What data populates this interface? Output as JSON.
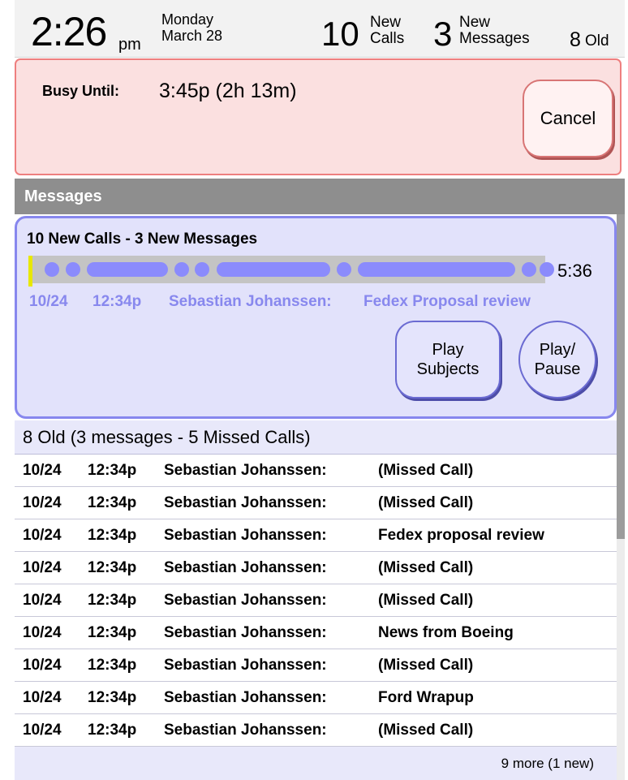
{
  "status_bar": {
    "time": "2:26",
    "ampm": "pm",
    "weekday": "Monday",
    "date": "March 28",
    "new_calls_count": "10",
    "new_calls_label_1": "New",
    "new_calls_label_2": "Calls",
    "new_messages_count": "3",
    "new_messages_label_1": "New",
    "new_messages_label_2": "Messages",
    "old_count": "8",
    "old_label": "Old"
  },
  "busy": {
    "label": "Busy Until:",
    "value": "3:45p (2h 13m)",
    "cancel_label": "Cancel"
  },
  "messages": {
    "header": "Messages",
    "new_summary": "10 New Calls - 3 New Messages",
    "total_duration": "5:36",
    "current": {
      "date": "10/24",
      "time": "12:34p",
      "name": "Sebastian Johanssen:",
      "subject": "Fedex Proposal review"
    },
    "play_subjects_line1": "Play",
    "play_subjects_line2": "Subjects",
    "play_pause_line1": "Play/",
    "play_pause_line2": "Pause",
    "colors": {
      "accent": "#8b8bfc",
      "playhead": "#e8e800",
      "card_bg": "#e2e2fb",
      "busy_bg": "#fbe0e0"
    }
  },
  "old_messages": {
    "header": "8 Old (3 messages - 5 Missed Calls)",
    "rows": [
      {
        "date": "10/24",
        "time": "12:34p",
        "name": "Sebastian Johanssen:",
        "subject": "(Missed Call)"
      },
      {
        "date": "10/24",
        "time": "12:34p",
        "name": "Sebastian Johanssen:",
        "subject": "(Missed Call)"
      },
      {
        "date": "10/24",
        "time": "12:34p",
        "name": "Sebastian Johanssen:",
        "subject": "Fedex proposal review"
      },
      {
        "date": "10/24",
        "time": "12:34p",
        "name": "Sebastian Johanssen:",
        "subject": "(Missed Call)"
      },
      {
        "date": "10/24",
        "time": "12:34p",
        "name": "Sebastian Johanssen:",
        "subject": "(Missed Call)"
      },
      {
        "date": "10/24",
        "time": "12:34p",
        "name": "Sebastian Johanssen:",
        "subject": "News from Boeing"
      },
      {
        "date": "10/24",
        "time": "12:34p",
        "name": "Sebastian Johanssen:",
        "subject": "(Missed Call)"
      },
      {
        "date": "10/24",
        "time": "12:34p",
        "name": "Sebastian Johanssen:",
        "subject": "Ford Wrapup"
      },
      {
        "date": "10/24",
        "time": "12:34p",
        "name": "Sebastian Johanssen:",
        "subject": "(Missed Call)"
      }
    ],
    "more_label": "9 more (1 new)"
  }
}
